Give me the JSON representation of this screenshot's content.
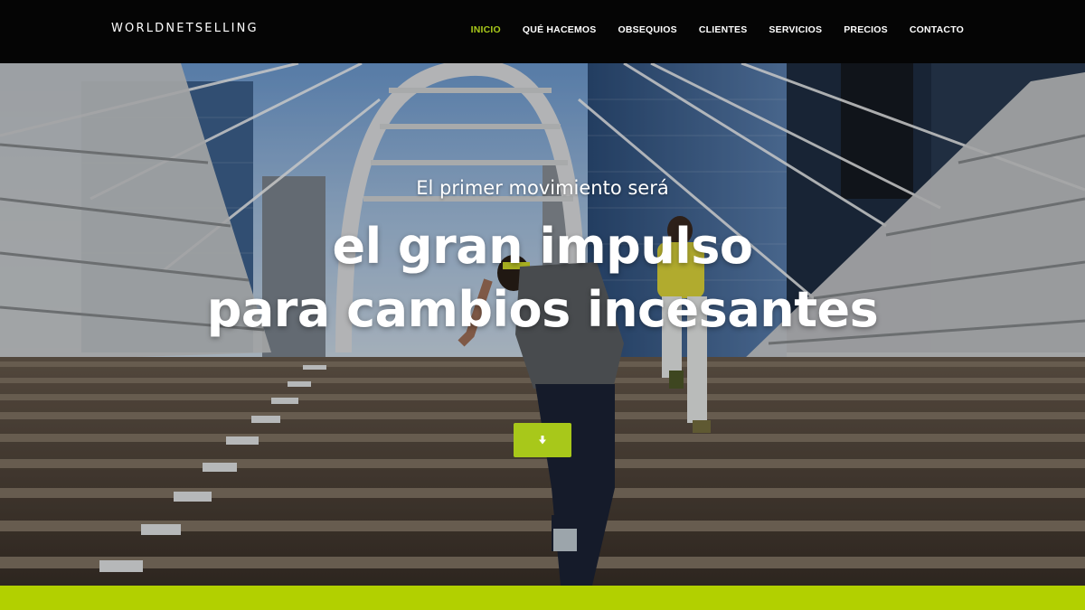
{
  "navbar": {
    "logo": "WORLDNETSELLING",
    "items": [
      {
        "label": "INICIO",
        "active": true
      },
      {
        "label": "QUÉ HACEMOS",
        "active": false
      },
      {
        "label": "OBSEQUIOS",
        "active": false
      },
      {
        "label": "CLIENTES",
        "active": false
      },
      {
        "label": "SERVICIOS",
        "active": false
      },
      {
        "label": "PRECIOS",
        "active": false
      },
      {
        "label": "CONTACTO",
        "active": false
      }
    ]
  },
  "hero": {
    "subtitle": "El primer movimiento será",
    "title_line1": "el gran impulso",
    "title_line2": "para cambios incesantes",
    "scroll_icon": "arrow-down-icon"
  },
  "colors": {
    "accent": "#a8c81a",
    "bottom_bar": "#b2d000",
    "navbar_bg": "#050505"
  }
}
